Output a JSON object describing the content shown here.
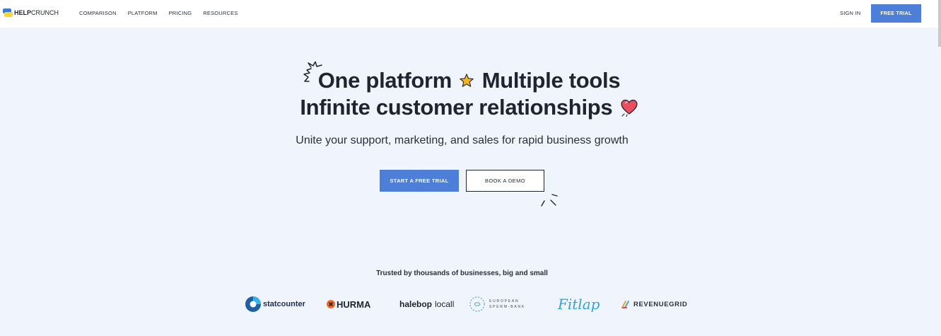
{
  "nav": {
    "logo_bold": "HELP",
    "logo_rest": "CRUNCH",
    "links": [
      "COMPARISON",
      "PLATFORM",
      "PRICING",
      "RESOURCES"
    ],
    "sign_in": "SIGN IN",
    "free_trial": "FREE TRIAL"
  },
  "hero": {
    "line1_part1": "One platform",
    "line1_part2": "Multiple tools",
    "line2": "Infinite customer relationships",
    "subtitle": "Unite your support, marketing, and sales for rapid business growth",
    "primary_cta": "START A FREE TRIAL",
    "secondary_cta": "BOOK A DEMO"
  },
  "trusted": {
    "heading": "Trusted by thousands of businesses, big and small",
    "brands": [
      "statcounter",
      "HURMA",
      "halebop",
      "locall",
      "EUROPEAN",
      "SPERM-BANK",
      "Fitlap",
      "REVENUEGRID"
    ]
  },
  "colors": {
    "accent": "#4d7fd9",
    "background": "#eff4fd",
    "text": "#1f2430",
    "star": "#f2b51e",
    "heart": "#ea4d5c"
  }
}
